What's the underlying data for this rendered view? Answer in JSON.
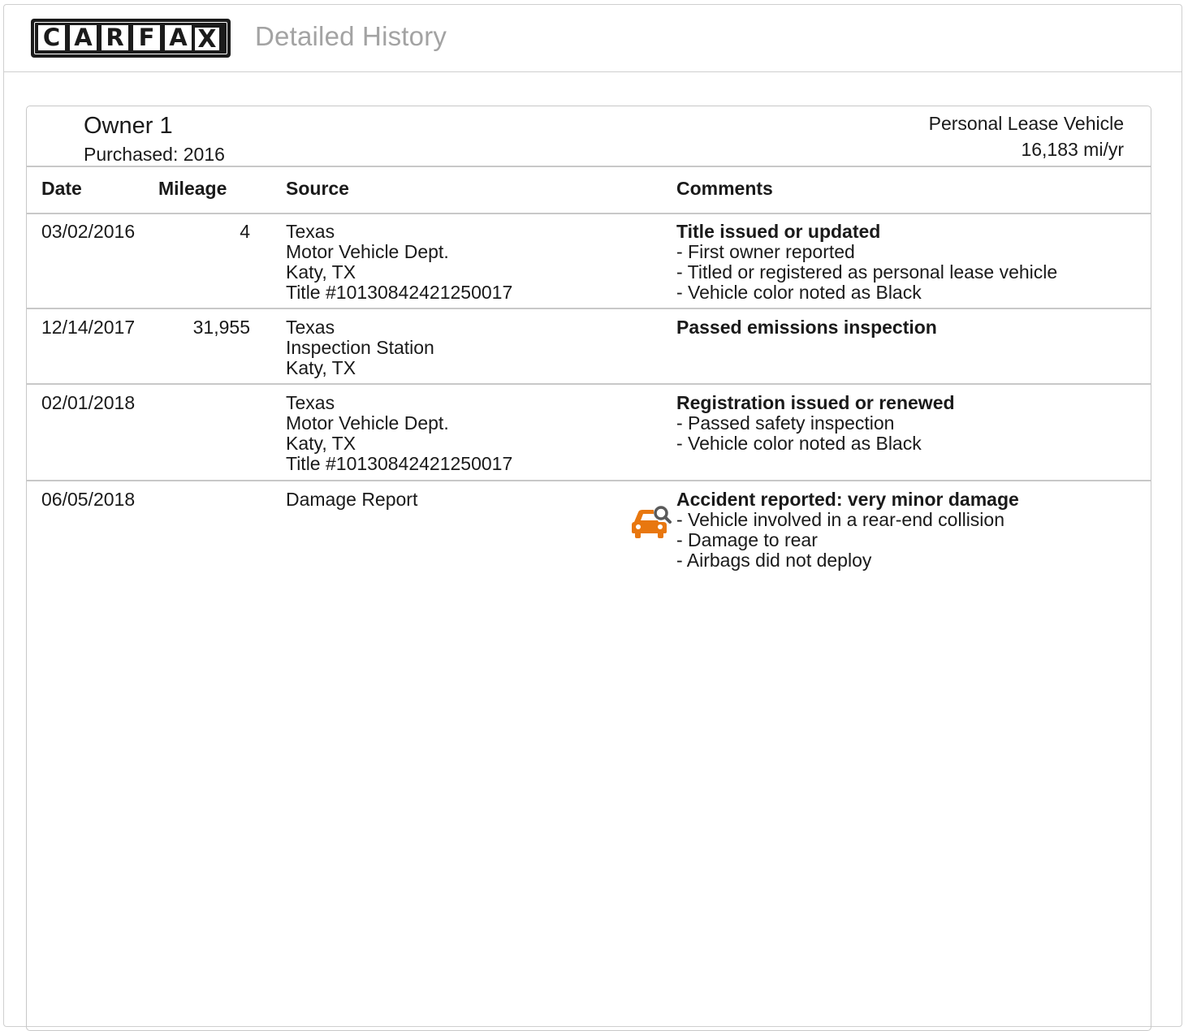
{
  "header": {
    "logo_letters": [
      "C",
      "A",
      "R",
      "F",
      "A",
      "X"
    ],
    "title": "Detailed History"
  },
  "owner": {
    "name": "Owner 1",
    "purchased": "Purchased: 2016",
    "type": "Personal Lease Vehicle",
    "miles_per_year": "16,183 mi/yr"
  },
  "columns": {
    "date": "Date",
    "mileage": "Mileage",
    "source": "Source",
    "comments": "Comments"
  },
  "rows": [
    {
      "date": "03/02/2016",
      "mileage": "4",
      "source": [
        "Texas",
        "Motor Vehicle Dept.",
        "Katy, TX",
        "Title #10130842421250017"
      ],
      "comment_title": "Title issued or updated",
      "comment_items": [
        "- First owner reported",
        "- Titled or registered as personal lease vehicle",
        "- Vehicle color noted as Black"
      ]
    },
    {
      "date": "12/14/2017",
      "mileage": "31,955",
      "source": [
        "Texas",
        "Inspection Station",
        "Katy, TX"
      ],
      "comment_title": "Passed emissions inspection",
      "comment_items": []
    },
    {
      "date": "02/01/2018",
      "mileage": "",
      "source": [
        "Texas",
        "Motor Vehicle Dept.",
        "Katy, TX",
        "Title #10130842421250017"
      ],
      "comment_title": "Registration issued or renewed",
      "comment_items": [
        "- Passed safety inspection",
        "- Vehicle color noted as Black"
      ]
    },
    {
      "date": "06/05/2018",
      "mileage": "",
      "source": [
        "Damage Report"
      ],
      "icon": "car-damage-search-icon",
      "comment_title": "Accident reported: very minor damage",
      "comment_items": [
        "- Vehicle involved in a rear-end collision",
        "- Damage to rear",
        "- Airbags did not deploy"
      ]
    }
  ],
  "colors": {
    "accent_orange": "#e8770f",
    "magnifier_gray": "#5a5a5a",
    "border": "#c8c8c8",
    "title_gray": "#a3a3a3"
  }
}
